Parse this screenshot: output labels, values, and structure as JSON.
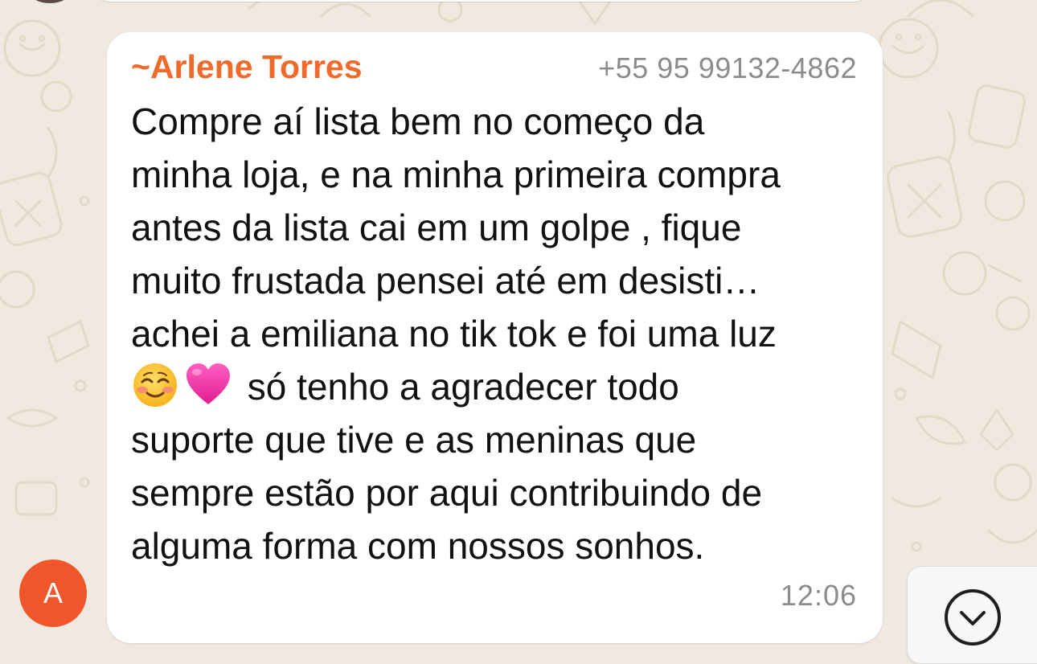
{
  "message": {
    "sender_prefix": "~",
    "sender_name": "Arlene Torres",
    "sender_phone": "+55 95 99132-4862",
    "lines": [
      "Compre aí lista bem no começo da",
      "minha loja, e na minha primeira compra",
      "antes da lista cai em um golpe , fique",
      "muito frustada pensei até em desisti…",
      "achei a emiliana no tik tok e foi uma luz",
      "só tenho a agradecer todo",
      "suporte que tive e as meninas que",
      "sempre estão por aqui contribuindo de",
      "alguma forma com nossos sonhos."
    ],
    "emojis": [
      "smiling-face-icon",
      "pink-heart-icon"
    ],
    "time": "12:06"
  },
  "avatar": {
    "initial": "A",
    "color": "#f0562a"
  },
  "colors": {
    "sender_name": "#f06a2b",
    "chat_background": "#efe9df",
    "bubble": "#ffffff",
    "meta_text": "#8c8c8c"
  },
  "scroll_button": {
    "icon": "chevron-down-icon"
  }
}
